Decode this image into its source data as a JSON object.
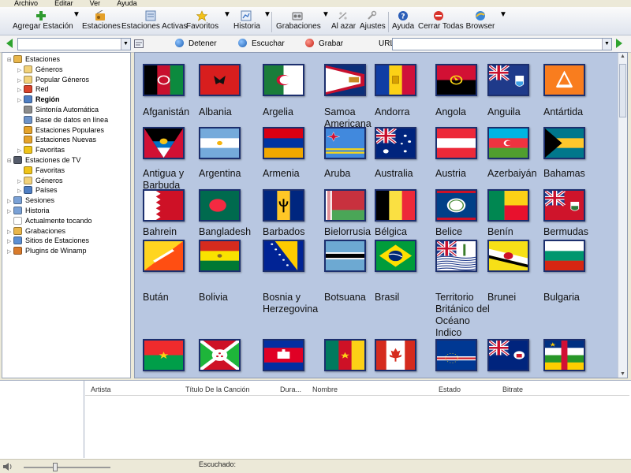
{
  "menu": [
    "Archivo",
    "Editar",
    "Ver",
    "Ayuda"
  ],
  "toolbar": {
    "add_station": "Agregar Estación",
    "stations": "Estaciones",
    "active_stations": "Estaciones Activas",
    "favorites": "Favoritos",
    "history": "Historia",
    "recordings": "Grabaciones",
    "random": "Al azar",
    "settings": "Ajustes",
    "help": "Ayuda",
    "close_all": "Cerrar Todas",
    "browser": "Browser"
  },
  "controls": {
    "stop": "Detener",
    "listen": "Escuchar",
    "record": "Grabar",
    "url_label": "URL"
  },
  "tree": [
    {
      "label": "Estaciones",
      "level": 0,
      "bold": false,
      "exp": "⊟",
      "icon": "folder-icon",
      "color": "#e9b64a"
    },
    {
      "label": "Géneros",
      "level": 1,
      "bold": false,
      "exp": "▷",
      "icon": "folder-icon",
      "color": "#f2d27a"
    },
    {
      "label": "Popular Géneros",
      "level": 1,
      "bold": false,
      "exp": "▷",
      "icon": "folder-icon",
      "color": "#f2d27a"
    },
    {
      "label": "Red",
      "level": 1,
      "bold": false,
      "exp": "▷",
      "icon": "network-icon",
      "color": "#d9442c"
    },
    {
      "label": "Región",
      "level": 1,
      "bold": true,
      "exp": "▷",
      "icon": "globe-icon",
      "color": "#4f7fc4"
    },
    {
      "label": "Sintonía Automática",
      "level": 1,
      "bold": false,
      "exp": "",
      "icon": "radar-icon",
      "color": "#8c8c8c"
    },
    {
      "label": "Base de datos en línea",
      "level": 1,
      "bold": false,
      "exp": "",
      "icon": "database-icon",
      "color": "#6d93c9"
    },
    {
      "label": "Estaciones Populares",
      "level": 1,
      "bold": false,
      "exp": "",
      "icon": "radio-icon",
      "color": "#e5a32b"
    },
    {
      "label": "Estaciones Nuevas",
      "level": 1,
      "bold": false,
      "exp": "",
      "icon": "radio-icon",
      "color": "#e5a32b"
    },
    {
      "label": "Favoritas",
      "level": 1,
      "bold": false,
      "exp": "▷",
      "icon": "star-icon",
      "color": "#f0c419"
    },
    {
      "label": "Estaciones de TV",
      "level": 0,
      "bold": false,
      "exp": "⊟",
      "icon": "tv-icon",
      "color": "#555c6b"
    },
    {
      "label": "Favoritas",
      "level": 1,
      "bold": false,
      "exp": "",
      "icon": "star-icon",
      "color": "#f0c419"
    },
    {
      "label": "Géneros",
      "level": 1,
      "bold": false,
      "exp": "▷",
      "icon": "folder-icon",
      "color": "#f2d27a"
    },
    {
      "label": "Países",
      "level": 1,
      "bold": false,
      "exp": "▷",
      "icon": "globe-icon",
      "color": "#4f7fc4"
    },
    {
      "label": "Sesiones",
      "level": 0,
      "bold": false,
      "exp": "▷",
      "icon": "session-icon",
      "color": "#7aa1d6"
    },
    {
      "label": "Historia",
      "level": 0,
      "bold": false,
      "exp": "▷",
      "icon": "history-icon",
      "color": "#7aa1d6"
    },
    {
      "label": "Actualmente tocando",
      "level": 0,
      "bold": false,
      "exp": "",
      "icon": "playing-icon",
      "color": "#ffffff"
    },
    {
      "label": "Grabaciones",
      "level": 0,
      "bold": false,
      "exp": "▷",
      "icon": "folder-icon",
      "color": "#e9b64a"
    },
    {
      "label": "Sitios de Estaciones",
      "level": 0,
      "bold": false,
      "exp": "▷",
      "icon": "web-icon",
      "color": "#5c8fd3"
    },
    {
      "label": "Plugins de Winamp",
      "level": 0,
      "bold": false,
      "exp": "▷",
      "icon": "plugin-icon",
      "color": "#d97b2b"
    }
  ],
  "countries": [
    {
      "name": "Afganistán",
      "flag": "afghanistan-flag"
    },
    {
      "name": "Albania",
      "flag": "albania-flag"
    },
    {
      "name": "Argelia",
      "flag": "algeria-flag"
    },
    {
      "name": "Samoa Americana",
      "flag": "american-samoa-flag"
    },
    {
      "name": "Andorra",
      "flag": "andorra-flag"
    },
    {
      "name": "Angola",
      "flag": "angola-flag"
    },
    {
      "name": "Anguila",
      "flag": "anguilla-flag"
    },
    {
      "name": "Antártida",
      "flag": "antarctica-flag"
    },
    {
      "name": "Antigua y Barbuda",
      "flag": "antigua-flag"
    },
    {
      "name": "Argentina",
      "flag": "argentina-flag"
    },
    {
      "name": "Armenia",
      "flag": "armenia-flag"
    },
    {
      "name": "Aruba",
      "flag": "aruba-flag"
    },
    {
      "name": "Australia",
      "flag": "australia-flag"
    },
    {
      "name": "Austria",
      "flag": "austria-flag"
    },
    {
      "name": "Azerbaiyán",
      "flag": "azerbaijan-flag"
    },
    {
      "name": "Bahamas",
      "flag": "bahamas-flag"
    },
    {
      "name": "Bahrein",
      "flag": "bahrain-flag"
    },
    {
      "name": "Bangladesh",
      "flag": "bangladesh-flag"
    },
    {
      "name": "Barbados",
      "flag": "barbados-flag"
    },
    {
      "name": "Bielorrusia",
      "flag": "belarus-flag"
    },
    {
      "name": "Bélgica",
      "flag": "belgium-flag"
    },
    {
      "name": "Belice",
      "flag": "belize-flag"
    },
    {
      "name": "Benín",
      "flag": "benin-flag"
    },
    {
      "name": "Bermudas",
      "flag": "bermuda-flag"
    },
    {
      "name": "Bután",
      "flag": "bhutan-flag"
    },
    {
      "name": "Bolivia",
      "flag": "bolivia-flag"
    },
    {
      "name": "Bosnia y Herzegovina",
      "flag": "bosnia-flag"
    },
    {
      "name": "Botsuana",
      "flag": "botswana-flag"
    },
    {
      "name": "Brasil",
      "flag": "brazil-flag"
    },
    {
      "name": "Territorio Británico del Océano Indico",
      "flag": "biot-flag"
    },
    {
      "name": "Brunei",
      "flag": "brunei-flag"
    },
    {
      "name": "Bulgaria",
      "flag": "bulgaria-flag"
    },
    {
      "name": "",
      "flag": "burkina-faso-flag"
    },
    {
      "name": "",
      "flag": "burundi-flag"
    },
    {
      "name": "",
      "flag": "cambodia-flag"
    },
    {
      "name": "",
      "flag": "cameroon-flag"
    },
    {
      "name": "",
      "flag": "canada-flag"
    },
    {
      "name": "",
      "flag": "cape-verde-flag"
    },
    {
      "name": "",
      "flag": "cayman-islands-flag"
    },
    {
      "name": "",
      "flag": "central-african-republic-flag"
    }
  ],
  "bottom_columns": [
    "Artista",
    "Título De la Canción",
    "Dura...",
    "Nombre",
    "Estado",
    "Bitrate"
  ],
  "status": {
    "heard": "Escuchado:"
  }
}
